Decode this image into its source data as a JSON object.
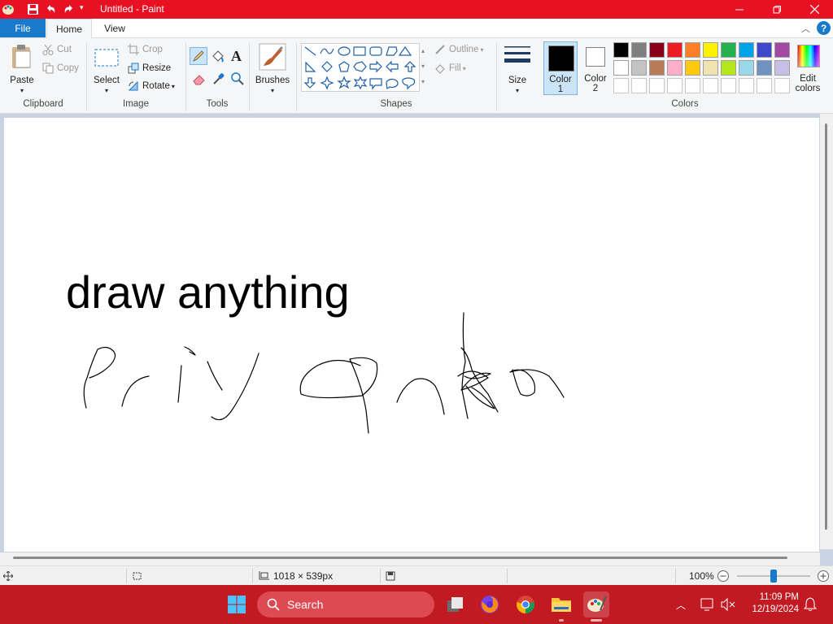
{
  "window": {
    "title": "Untitled - Paint"
  },
  "tabs": {
    "file": "File",
    "home": "Home",
    "view": "View"
  },
  "clipboard": {
    "paste": "Paste",
    "cut": "Cut",
    "copy": "Copy",
    "group": "Clipboard"
  },
  "image": {
    "select": "Select",
    "crop": "Crop",
    "resize": "Resize",
    "rotate": "Rotate",
    "group": "Image"
  },
  "tools": {
    "group": "Tools"
  },
  "brushes": {
    "label": "Brushes"
  },
  "shapes": {
    "outline": "Outline",
    "fill": "Fill",
    "group": "Shapes"
  },
  "size": {
    "label": "Size"
  },
  "color1": {
    "label": "Color",
    "num": "1",
    "value": "#000000"
  },
  "color2": {
    "label": "Color",
    "num": "2",
    "value": "#ffffff"
  },
  "colors": {
    "group": "Colors",
    "edit_line1": "Edit",
    "edit_line2": "colors",
    "palette_row1": [
      "#000000",
      "#7f7f7f",
      "#880015",
      "#ed1c24",
      "#ff7f27",
      "#fff200",
      "#22b14c",
      "#00a2e8",
      "#3f48cc",
      "#a349a4"
    ],
    "palette_row2": [
      "#ffffff",
      "#c3c3c3",
      "#b97a57",
      "#ffaec9",
      "#ffc90e",
      "#efe4b0",
      "#b5e61d",
      "#99d9ea",
      "#7092be",
      "#c8bfe7"
    ],
    "palette_row3": [
      "#ffffff",
      "#ffffff",
      "#ffffff",
      "#ffffff",
      "#ffffff",
      "#ffffff",
      "#ffffff",
      "#ffffff",
      "#ffffff",
      "#ffffff"
    ]
  },
  "canvas": {
    "text": "draw anything"
  },
  "status": {
    "dimensions": "1018 × 539px",
    "zoom": "100%"
  },
  "taskbar": {
    "search": "Search",
    "time": "11:09 PM",
    "date": "12/19/2024"
  }
}
